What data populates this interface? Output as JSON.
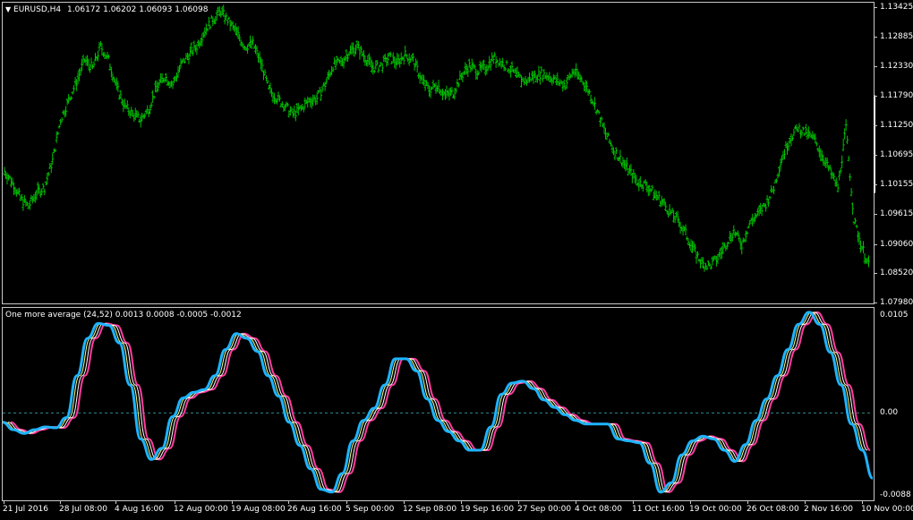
{
  "main_chart": {
    "symbol_label": "EURUSD,H4",
    "ohlc": "1.06172 1.06202 1.06093 1.06098",
    "price_labels": [
      "1.13425",
      "1.12885",
      "1.12330",
      "1.11790",
      "1.11250",
      "1.10695",
      "1.10155",
      "1.09615",
      "1.09060",
      "1.08520",
      "1.07980"
    ],
    "ylim": [
      1.0798,
      1.13425
    ],
    "bar_color": "#00c000",
    "series": {
      "name": "",
      "values": [
        1.104,
        1.102,
        1.099,
        1.0975,
        1.1,
        1.101,
        1.106,
        1.1135,
        1.117,
        1.1205,
        1.1245,
        1.123,
        1.127,
        1.1245,
        1.1195,
        1.116,
        1.1145,
        1.1135,
        1.1155,
        1.1195,
        1.1215,
        1.12,
        1.1235,
        1.1255,
        1.127,
        1.13,
        1.132,
        1.1335,
        1.1315,
        1.1295,
        1.127,
        1.1275,
        1.124,
        1.119,
        1.1175,
        1.116,
        1.1145,
        1.1155,
        1.117,
        1.1175,
        1.12,
        1.1235,
        1.124,
        1.126,
        1.127,
        1.125,
        1.123,
        1.1235,
        1.125,
        1.124,
        1.1255,
        1.1245,
        1.121,
        1.119,
        1.12,
        1.118,
        1.1185,
        1.1215,
        1.1235,
        1.1225,
        1.123,
        1.125,
        1.124,
        1.123,
        1.1215,
        1.1205,
        1.1215,
        1.122,
        1.1215,
        1.1205,
        1.12,
        1.1225,
        1.121,
        1.1185,
        1.115,
        1.111,
        1.108,
        1.106,
        1.104,
        1.102,
        1.1015,
        1.1,
        1.0985,
        1.0965,
        1.095,
        1.0925,
        1.0895,
        1.087,
        1.0865,
        1.088,
        1.0905,
        1.093,
        1.0905,
        1.0945,
        1.096,
        1.098,
        1.101,
        1.1065,
        1.11,
        1.112,
        1.111,
        1.11,
        1.107,
        1.104,
        1.101,
        1.112,
        1.095,
        1.09,
        1.086
      ]
    },
    "x_labels": [
      "21 Jul 2016",
      "28 Jul 08:00",
      "4 Aug 16:00",
      "12 Aug 00:00",
      "19 Aug 08:00",
      "26 Aug 16:00",
      "5 Sep 00:00",
      "12 Sep 08:00",
      "19 Sep 16:00",
      "27 Sep 00:00",
      "4 Oct 08:00",
      "11 Oct 16:00",
      "19 Oct 00:00",
      "26 Oct 08:00",
      "2 Nov 16:00",
      "10 Nov 00:00"
    ]
  },
  "indicator": {
    "label": "One more average (24,52) 0.0013 0.0008 -0.0005 -0.0012",
    "scale_labels": [
      "0.0105",
      "0.00",
      "-0.0088"
    ],
    "ylim": [
      -0.0088,
      0.0105
    ],
    "zero_color": "#2e8b8b",
    "series": [
      {
        "name": "",
        "color": "#1eb4ff",
        "width": 3,
        "shift": 0
      },
      {
        "name": "",
        "color": "#ffff80",
        "width": 1,
        "shift": 3
      },
      {
        "name": "",
        "color": "#ffffff",
        "width": 1,
        "shift": 6
      },
      {
        "name": "",
        "color": "#ff3c9e",
        "width": 2,
        "shift": 9
      }
    ],
    "values": [
      -0.001,
      -0.0018,
      -0.0022,
      -0.0018,
      -0.0015,
      -0.0016,
      -0.0005,
      0.004,
      0.008,
      0.0096,
      0.0094,
      0.0075,
      0.003,
      -0.0028,
      -0.005,
      -0.0038,
      -0.0004,
      0.0016,
      0.0022,
      0.0025,
      0.004,
      0.0068,
      0.0085,
      0.008,
      0.0066,
      0.004,
      0.0018,
      -0.001,
      -0.0035,
      -0.006,
      -0.0082,
      -0.0085,
      -0.0065,
      -0.003,
      -0.0008,
      0.0005,
      0.003,
      0.0058,
      0.0058,
      0.0045,
      0.0015,
      -0.0008,
      -0.002,
      -0.003,
      -0.004,
      -0.004,
      -0.0015,
      0.002,
      0.0032,
      0.0034,
      0.0026,
      0.0014,
      0.0006,
      -0.0002,
      -0.0008,
      -0.0012,
      -0.0012,
      -0.0012,
      -0.0028,
      -0.003,
      -0.0032,
      -0.0054,
      -0.0085,
      -0.0075,
      -0.0045,
      -0.003,
      -0.0025,
      -0.0028,
      -0.004,
      -0.0052,
      -0.0034,
      -0.0008,
      0.0015,
      0.004,
      0.0068,
      0.0095,
      0.0108,
      0.0095,
      0.0065,
      0.003,
      -0.0012,
      -0.004,
      -0.007
    ]
  }
}
